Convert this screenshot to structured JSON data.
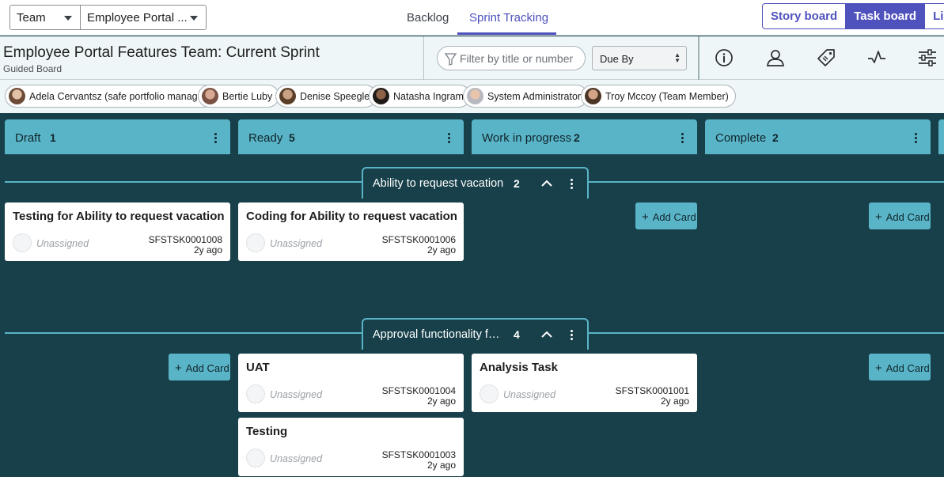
{
  "topnav": {
    "team_select": "Team",
    "board_select": "Employee Portal ...",
    "tabs": [
      "Backlog",
      "Sprint Tracking"
    ],
    "view_toggle": [
      "Story board",
      "Task board",
      "List"
    ]
  },
  "header": {
    "title": "Employee Portal Features Team: Current Sprint",
    "subtitle": "Guided Board",
    "filter_placeholder": "Filter by title or number",
    "sort_value": "Due By"
  },
  "members": [
    "Adela Cervantsz (safe portfolio manager)",
    "Bertie Luby",
    "Denise Speegle",
    "Natasha Ingram",
    "System Administrator",
    "Troy Mccoy (Team Member)"
  ],
  "columns": [
    {
      "name": "Draft",
      "count": "1"
    },
    {
      "name": "Ready",
      "count": "5"
    },
    {
      "name": "Work in progress",
      "count": "2"
    },
    {
      "name": "Complete",
      "count": "2"
    }
  ],
  "lanes": [
    {
      "name": "Ability to request vacation",
      "count": "2",
      "cards": [
        {
          "title": "Testing for Ability to request vacation",
          "assignee": "Unassigned",
          "number": "SFSTSK0001008",
          "age": "2y ago"
        },
        {
          "title": "Coding for Ability to request vacation",
          "assignee": "Unassigned",
          "number": "SFSTSK0001006",
          "age": "2y ago"
        }
      ]
    },
    {
      "name": "Approval functionality f…",
      "count": "4",
      "cards": [
        {
          "title": "UAT",
          "assignee": "Unassigned",
          "number": "SFSTSK0001004",
          "age": "2y ago"
        },
        {
          "title": "Analysis Task",
          "assignee": "Unassigned",
          "number": "SFSTSK0001001",
          "age": "2y ago"
        },
        {
          "title": "Testing",
          "assignee": "Unassigned",
          "number": "SFSTSK0001003",
          "age": "2y ago"
        }
      ]
    }
  ],
  "add_card_label": "Add Card",
  "colors": {
    "accent": "#4f52bd",
    "board_bg": "#17404a",
    "column": "#5ab4c8"
  }
}
